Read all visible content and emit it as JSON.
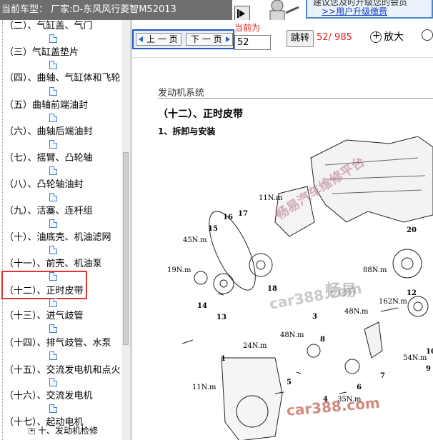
{
  "window": {
    "title": "当前车型：  厂家:D-东风风行菱智M52013"
  },
  "promo": {
    "line1": "建议您及时升级您的会员",
    "link": ">>用户升级缴费"
  },
  "tree": {
    "items": [
      {
        "label": "（二）、气缸盖、气门"
      },
      {
        "label": "（三）气缸盖垫片"
      },
      {
        "label": "（四）、曲轴、气缸体和飞轮"
      },
      {
        "label": "（五）曲轴前端油封"
      },
      {
        "label": "（六）、曲轴后端油封"
      },
      {
        "label": "（七）、摇臂、凸轮轴"
      },
      {
        "label": "（八）、凸轮轴油封"
      },
      {
        "label": "（九）、活塞、连杆组"
      },
      {
        "label": "（十）、油底壳、机油滤网"
      },
      {
        "label": "（十一）、前壳、机油泵"
      },
      {
        "label": "（十二）、正时皮带"
      },
      {
        "label": "（十三）、进气歧管"
      },
      {
        "label": "（十四）、排气歧管、水泵"
      },
      {
        "label": "（十五）、交流发电机和点火"
      },
      {
        "label": "（十六）、交流发电机"
      },
      {
        "label": "（十七）、起动电机"
      }
    ],
    "subitem": "十、发动机检修"
  },
  "toolbar": {
    "prev_label": "上 一 页",
    "next_label": "下 一 页",
    "current_label": "当前为",
    "page_value": "52",
    "jump_label": "跳转",
    "page_count": "52/ 985",
    "zoom_in_label": "放大"
  },
  "document": {
    "section": "发动机系统",
    "heading": "（十二）、正时皮带",
    "subheading": "1、拆卸与安装",
    "watermark1": "畅易汽车维修平台",
    "watermark2": "畅易",
    "watermark3": "car388.com",
    "watermark4": "car388.com",
    "torque": [
      "11N.m",
      "45N.m",
      "19N.m",
      "88N.m",
      "48N.m",
      "48N.m",
      "162N.m",
      "24N.m",
      "54N.m",
      "35N.m",
      "11N.m"
    ],
    "parts": [
      "17",
      "16",
      "15",
      "14",
      "13",
      "18",
      "20",
      "12",
      "3",
      "8",
      "1",
      "5",
      "4",
      "6",
      "7",
      "10",
      "9"
    ]
  }
}
